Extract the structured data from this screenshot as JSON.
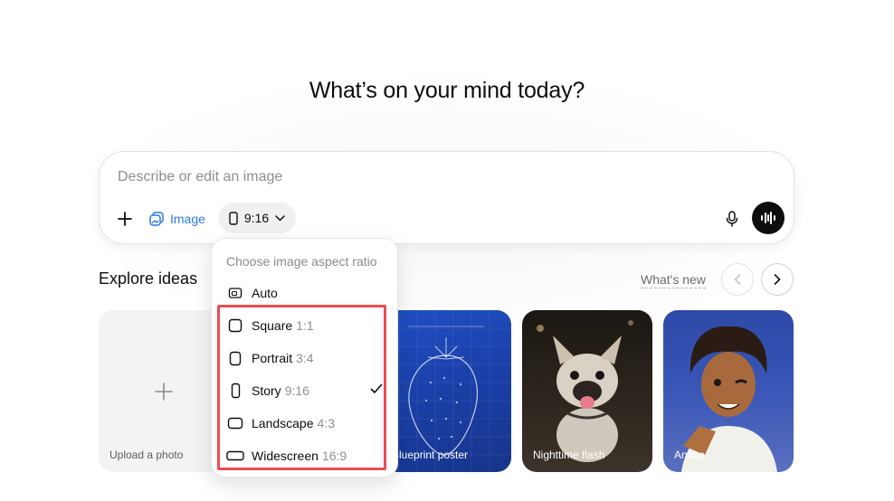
{
  "headline": "What’s on your mind today?",
  "composer": {
    "placeholder": "Describe or edit an image",
    "image_chip_label": "Image",
    "ratio_chip_label": "9:16"
  },
  "explore": {
    "title": "Explore ideas",
    "whats_new": "What's new"
  },
  "cards": [
    {
      "label": "Upload a photo"
    },
    {
      "label": "Blueprint poster"
    },
    {
      "label": "Nighttime flash"
    },
    {
      "label": "Anime"
    }
  ],
  "dropdown": {
    "title": "Choose image aspect ratio",
    "items": [
      {
        "label": "Auto",
        "ratio": "",
        "selected": false
      },
      {
        "label": "Square",
        "ratio": "1:1",
        "selected": false
      },
      {
        "label": "Portrait",
        "ratio": "3:4",
        "selected": false
      },
      {
        "label": "Story",
        "ratio": "9:16",
        "selected": true
      },
      {
        "label": "Landscape",
        "ratio": "4:3",
        "selected": false
      },
      {
        "label": "Widescreen",
        "ratio": "16:9",
        "selected": false
      }
    ]
  },
  "colors": {
    "accent_blue": "#2a7ae2",
    "highlight_red": "#ea4d55"
  }
}
